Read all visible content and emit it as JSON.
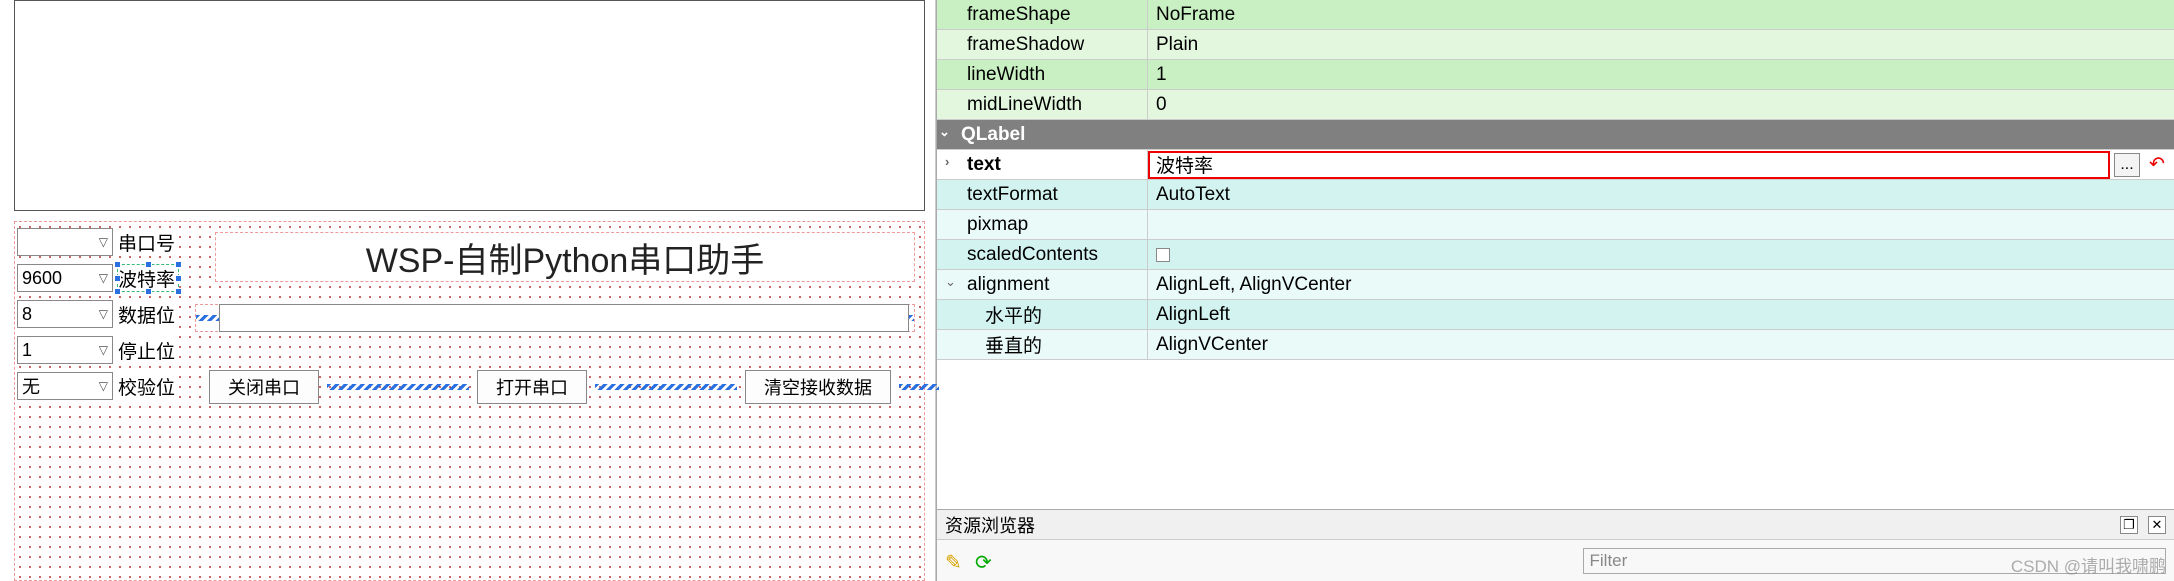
{
  "designer": {
    "title_label": "WSP-自制Python串口助手",
    "fields": [
      {
        "value": "",
        "label": "串口号"
      },
      {
        "value": "9600",
        "label": "波特率"
      },
      {
        "value": "8",
        "label": "数据位"
      },
      {
        "value": "1",
        "label": "停止位"
      },
      {
        "value": "无",
        "label": "校验位"
      }
    ],
    "buttons": {
      "close": "关闭串口",
      "open": "打开串口",
      "clear": "清空接收数据"
    },
    "selected_label_index": 1
  },
  "properties": {
    "green_rows": [
      {
        "key": "frameShape",
        "val": "NoFrame"
      },
      {
        "key": "frameShadow",
        "val": "Plain"
      },
      {
        "key": "lineWidth",
        "val": "1"
      },
      {
        "key": "midLineWidth",
        "val": "0"
      }
    ],
    "section": "QLabel",
    "text_row": {
      "key": "text",
      "val": "波特率"
    },
    "cyan_rows": [
      {
        "key": "textFormat",
        "val": "AutoText"
      },
      {
        "key": "pixmap",
        "val": ""
      },
      {
        "key": "scaledContents",
        "val": "",
        "checkbox": true
      },
      {
        "key": "alignment",
        "val": "AlignLeft, AlignVCenter",
        "expandable": true
      },
      {
        "key": "水平的",
        "val": "AlignLeft",
        "sub": true
      },
      {
        "key": "垂直的",
        "val": "AlignVCenter",
        "sub": true
      }
    ]
  },
  "resource_browser": {
    "title": "资源浏览器",
    "filter_placeholder": "Filter"
  },
  "watermark": "CSDN @请叫我啸鹏"
}
